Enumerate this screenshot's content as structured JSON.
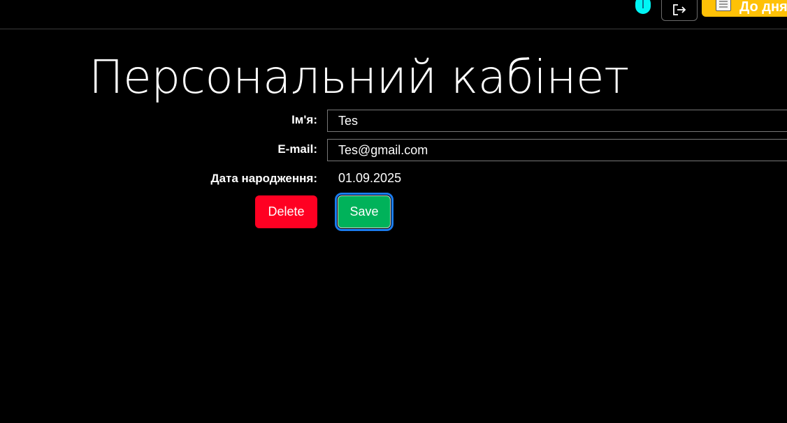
{
  "header": {
    "logout_icon": "logout-icon",
    "avatar_icon": "user-avatar-icon",
    "diary_button_label": "До дня",
    "diary_icon": "notebook-icon",
    "accent_color": "#ffc107"
  },
  "main": {
    "title": "Персональний кабінет",
    "fields": {
      "name_label": "Ім'я:",
      "name_value": "Tes",
      "email_label": "E-mail:",
      "email_value": "Tes@gmail.com",
      "birthdate_label": "Дата народження:",
      "birthdate_value": "01.09.2025"
    },
    "actions": {
      "delete_label": "Delete",
      "delete_color": "#ff0022",
      "save_label": "Save",
      "save_color": "#00b25a"
    }
  }
}
